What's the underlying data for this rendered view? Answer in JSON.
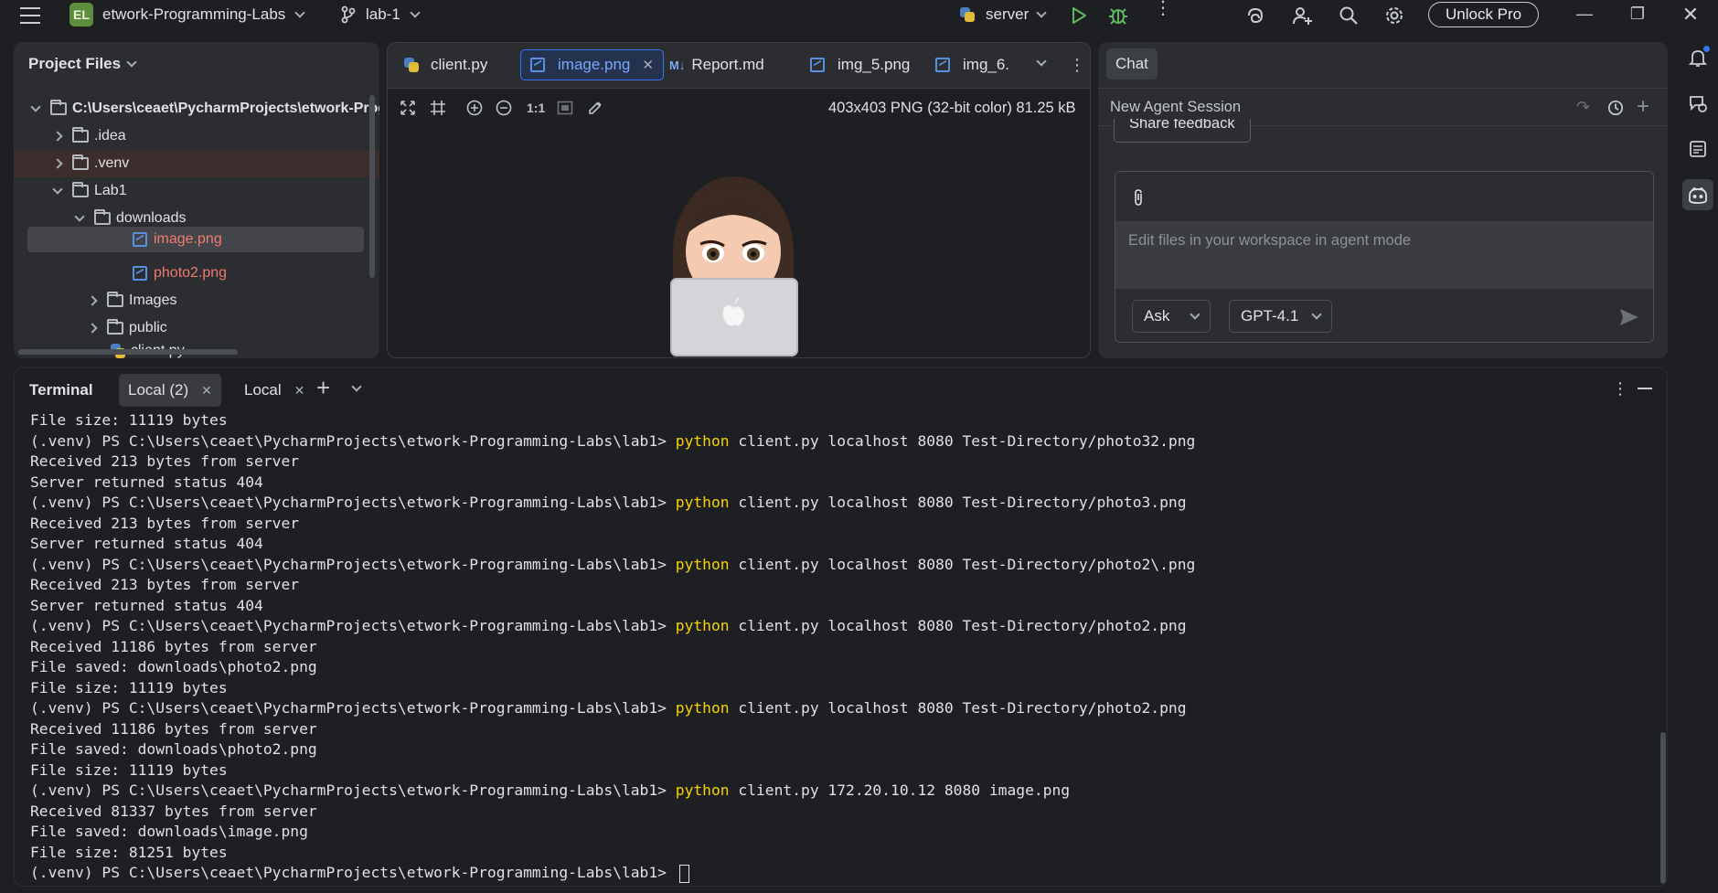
{
  "titlebar": {
    "project_badge": "EL",
    "project_name": "etwork-Programming-Labs",
    "branch": "lab-1",
    "run_config": "server",
    "unlock_label": "Unlock Pro"
  },
  "project_panel": {
    "title": "Project Files",
    "tree": [
      {
        "label": "C:\\Users\\ceaet\\PycharmProjects\\etwork-Programming-Labs",
        "type": "folder"
      },
      {
        "label": ".idea",
        "type": "folder"
      },
      {
        "label": ".venv",
        "type": "folder"
      },
      {
        "label": "Lab1",
        "type": "folder"
      },
      {
        "label": "downloads",
        "type": "folder"
      },
      {
        "label": "image.png",
        "type": "image"
      },
      {
        "label": "photo2.png",
        "type": "image"
      },
      {
        "label": "Images",
        "type": "folder"
      },
      {
        "label": "public",
        "type": "folder"
      },
      {
        "label": "client.py",
        "type": "python"
      }
    ]
  },
  "editor": {
    "tabs": [
      {
        "label": "client.py"
      },
      {
        "label": "image.png"
      },
      {
        "label": "Report.md"
      },
      {
        "label": "img_5.png"
      },
      {
        "label": "img_6."
      }
    ],
    "md_badge": "M↓",
    "zoom_actual": "1:1",
    "image_info": "403x403 PNG (32-bit color) 81.25 kB"
  },
  "chat": {
    "tab": "Chat",
    "session_title": "New Agent Session",
    "share_feedback": "Share feedback",
    "placeholder": "Edit files in your workspace in agent mode",
    "mode": "Ask",
    "model": "GPT-4.1"
  },
  "terminal": {
    "title": "Terminal",
    "tabs": [
      {
        "label": "Local (2)"
      },
      {
        "label": "Local"
      }
    ],
    "lines": [
      {
        "text": "File size: 11119 bytes"
      },
      {
        "prompt": "(.venv) PS C:\\Users\\ceaet\\PycharmProjects\\etwork-Programming-Labs\\lab1> ",
        "cmd": "python",
        "args": " client.py localhost 8080 Test-Directory/photo32.png"
      },
      {
        "text": "Received 213 bytes from server"
      },
      {
        "text": "Server returned status 404"
      },
      {
        "prompt": "(.venv) PS C:\\Users\\ceaet\\PycharmProjects\\etwork-Programming-Labs\\lab1> ",
        "cmd": "python",
        "args": " client.py localhost 8080 Test-Directory/photo3.png"
      },
      {
        "text": "Received 213 bytes from server"
      },
      {
        "text": "Server returned status 404"
      },
      {
        "prompt": "(.venv) PS C:\\Users\\ceaet\\PycharmProjects\\etwork-Programming-Labs\\lab1> ",
        "cmd": "python",
        "args": " client.py localhost 8080 Test-Directory/photo2\\.png"
      },
      {
        "text": "Received 213 bytes from server"
      },
      {
        "text": "Server returned status 404"
      },
      {
        "prompt": "(.venv) PS C:\\Users\\ceaet\\PycharmProjects\\etwork-Programming-Labs\\lab1> ",
        "cmd": "python",
        "args": " client.py localhost 8080 Test-Directory/photo2.png"
      },
      {
        "text": "Received 11186 bytes from server"
      },
      {
        "text": "File saved: downloads\\photo2.png"
      },
      {
        "text": "File size: 11119 bytes"
      },
      {
        "prompt": "(.venv) PS C:\\Users\\ceaet\\PycharmProjects\\etwork-Programming-Labs\\lab1> ",
        "cmd": "python",
        "args": " client.py localhost 8080 Test-Directory/photo2.png"
      },
      {
        "text": "Received 11186 bytes from server"
      },
      {
        "text": "File saved: downloads\\photo2.png"
      },
      {
        "text": "File size: 11119 bytes"
      },
      {
        "prompt": "(.venv) PS C:\\Users\\ceaet\\PycharmProjects\\etwork-Programming-Labs\\lab1> ",
        "cmd": "python",
        "args": " client.py 172.20.10.12 8080 image.png"
      },
      {
        "text": "Received 81337 bytes from server"
      },
      {
        "text": "File saved: downloads\\image.png"
      },
      {
        "text": "File size: 81251 bytes"
      }
    ],
    "final_prompt": "(.venv) PS C:\\Users\\ceaet\\PycharmProjects\\etwork-Programming-Labs\\lab1> "
  },
  "colors": {
    "accent": "#3574f0",
    "command": "#f5d400",
    "modified_file": "#f07b6e",
    "run_green": "#5fb85f"
  }
}
